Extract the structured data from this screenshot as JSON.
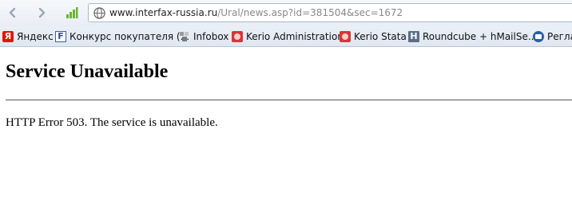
{
  "browser": {
    "address_bar": {
      "host": "www.interfax-russia.ru",
      "path": "/Ural/news.asp?id=381504&sec=1672"
    },
    "bookmarks": [
      {
        "label": "Яндекс",
        "icon": "yandex-icon"
      },
      {
        "label": "Конкурс покупателя (...",
        "icon": "f-icon"
      },
      {
        "label": "Infobox",
        "icon": "infobox-icon"
      },
      {
        "label": "Kerio Administration",
        "icon": "kerio-icon"
      },
      {
        "label": "Kerio Stata",
        "icon": "kerio-icon"
      },
      {
        "label": "Roundcube + hMailSe...",
        "icon": "h-icon"
      },
      {
        "label": "Регла",
        "icon": "reg-icon"
      }
    ]
  },
  "page": {
    "title": "Service Unavailable",
    "message": "HTTP Error 503. The service is unavailable."
  }
}
